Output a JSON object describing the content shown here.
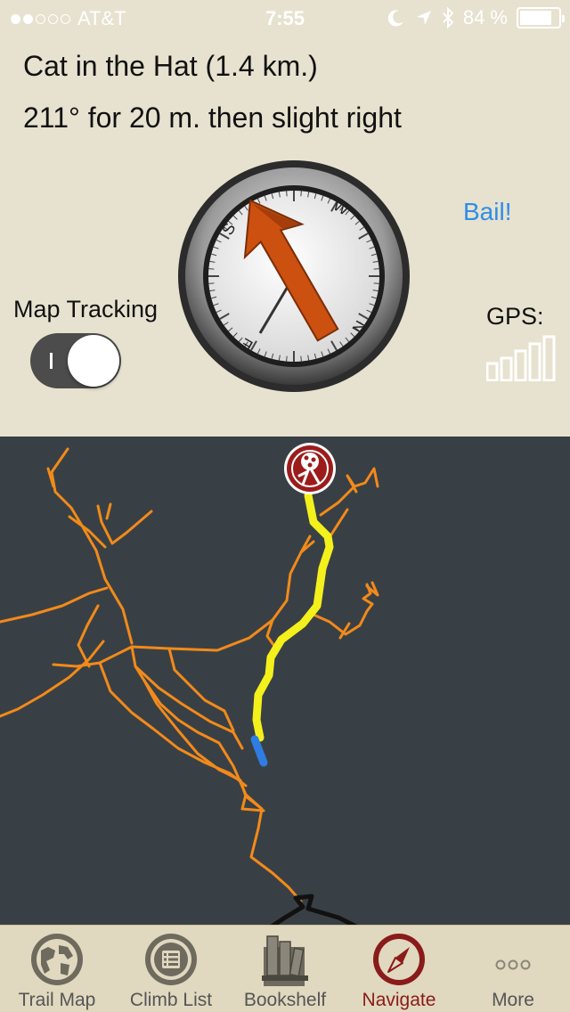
{
  "status_bar": {
    "carrier": "AT&T",
    "time": "7:55",
    "battery_percent": "84 %",
    "signal_dots_filled": 2,
    "signal_dots_total": 5
  },
  "navigation": {
    "destination": "Cat in the Hat (1.4 km.)",
    "instruction": "211° for 20 m. then slight right",
    "bail_label": "Bail!",
    "map_tracking_label": "Map Tracking",
    "map_tracking_on": true,
    "gps_label": "GPS:",
    "gps_bars_filled": 5,
    "gps_bars_total": 5,
    "compass_letters": [
      "W",
      "N",
      "E",
      "S"
    ]
  },
  "map": {
    "background_color": "#394045",
    "trail_color": "#f28a1a",
    "route_color": "#f4f01c",
    "position_color": "#2f7de0",
    "destination_marker_icon": "climber-marker-icon"
  },
  "tab_bar": {
    "items": [
      {
        "label": "Trail Map",
        "icon": "globe-icon"
      },
      {
        "label": "Climb List",
        "icon": "list-icon"
      },
      {
        "label": "Bookshelf",
        "icon": "books-icon"
      },
      {
        "label": "Navigate",
        "icon": "compass-icon",
        "active": true
      },
      {
        "label": "More",
        "icon": "more-icon"
      }
    ],
    "active_color": "#8a1b1b"
  }
}
